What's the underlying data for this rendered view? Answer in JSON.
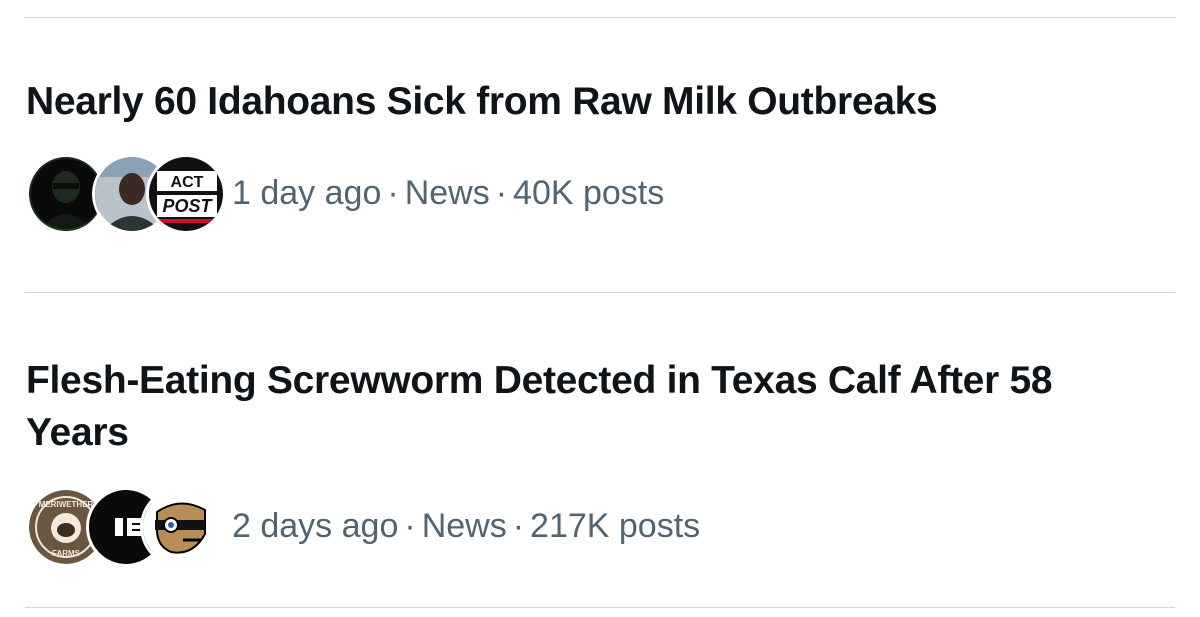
{
  "trends": [
    {
      "title": "Nearly 60 Idahoans Sick from Raw Milk Outbreaks",
      "time": "1 day ago",
      "category": "News",
      "posts": "40K posts",
      "avatars": [
        {
          "icon": "masked-figure-avatar"
        },
        {
          "icon": "person-photo-avatar"
        },
        {
          "icon": "fact-post-logo-avatar",
          "text_top": "ACT",
          "text_bottom": "POST"
        }
      ]
    },
    {
      "title": "Flesh-Eating Screwworm Detected in Texas Calf After 58 Years",
      "time": "2 days ago",
      "category": "News",
      "posts": "217K posts",
      "avatars": [
        {
          "icon": "meriwether-farms-logo-avatar",
          "text_top": "MERIWETHER",
          "text_bottom": "FARMS"
        },
        {
          "icon": "black-logo-avatar"
        },
        {
          "icon": "cartoon-character-avatar"
        }
      ]
    }
  ],
  "separator": "·",
  "colors": {
    "title": "#0f1419",
    "meta": "#536471",
    "divider": "#cfd9de"
  }
}
